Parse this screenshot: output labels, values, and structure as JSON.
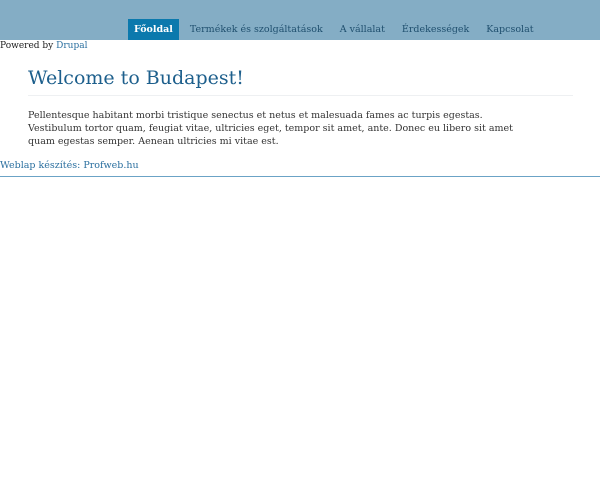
{
  "nav": {
    "items": [
      {
        "label": "Főoldal",
        "active": true
      },
      {
        "label": "Termékek és szolgáltatások",
        "active": false
      },
      {
        "label": "A vállalat",
        "active": false
      },
      {
        "label": "Érdekességek",
        "active": false
      },
      {
        "label": "Kapcsolat",
        "active": false
      }
    ]
  },
  "powered": {
    "prefix": "Powered by",
    "link": "Drupal"
  },
  "page": {
    "title": "Welcome to Budapest!",
    "body": "Pellentesque habitant morbi tristique senectus et netus et malesuada fames ac turpis egestas. Vestibulum tortor quam, feugiat vitae, ultricies eget, tempor sit amet, ante. Donec eu libero sit amet quam egestas semper. Aenean ultricies mi vitae est."
  },
  "footer": {
    "link": "Weblap készítés: Profweb.hu"
  },
  "colors": {
    "topbar": "#84adc5",
    "active_tab": "#0b79ad",
    "link": "#2a6f9f",
    "title": "#1d5f8c"
  }
}
